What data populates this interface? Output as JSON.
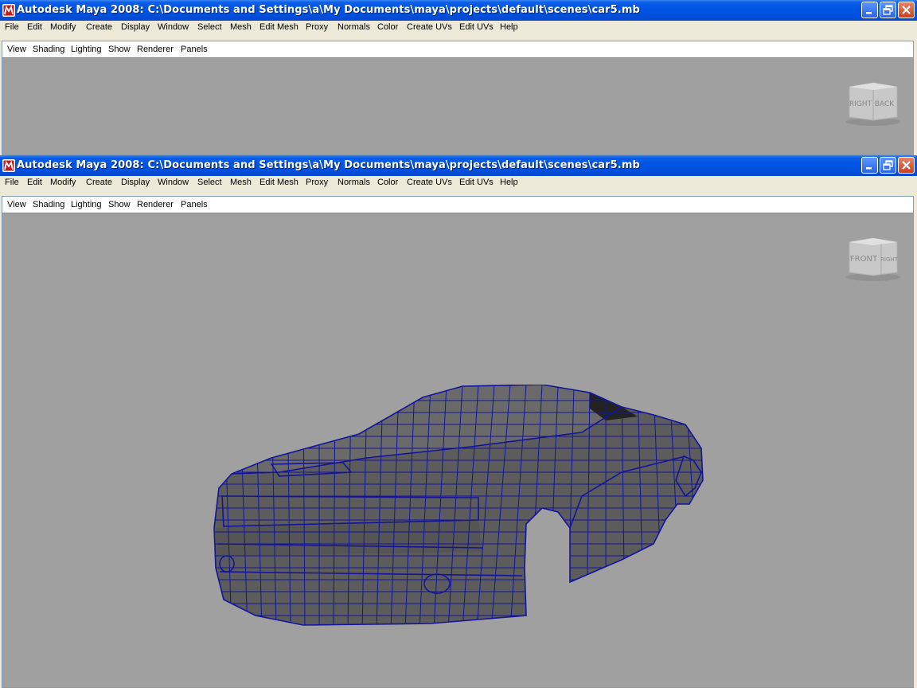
{
  "colors": {
    "titlebar": "#0055e5",
    "viewport": "#a0a0a0",
    "wire": "#1a1aa0",
    "mesh": "#5a5a5a"
  },
  "menus": [
    "File",
    "Edit",
    "Modify",
    "Create",
    "Display",
    "Window",
    "Select",
    "Mesh",
    "Edit Mesh",
    "Proxy",
    "Normals",
    "Color",
    "Create UVs",
    "Edit UVs",
    "Help"
  ],
  "panel_menus": [
    "View",
    "Shading",
    "Lighting",
    "Show",
    "Renderer",
    "Panels"
  ],
  "windows": [
    {
      "title": "Autodesk Maya 2008: C:\\Documents and Settings\\a\\My Documents\\maya\\projects\\default\\scenes\\car5.mb",
      "viewcube_left": "RIGHT",
      "viewcube_right": "BACK"
    },
    {
      "title": "Autodesk Maya 2008: C:\\Documents and Settings\\a\\My Documents\\maya\\projects\\default\\scenes\\car5.mb",
      "viewcube_left": "FRONT",
      "viewcube_right": "RIGHT"
    }
  ],
  "icons": {
    "app": "maya-app-icon",
    "minimize": "minimize-icon",
    "maximize": "restore-icon",
    "close": "close-icon"
  }
}
